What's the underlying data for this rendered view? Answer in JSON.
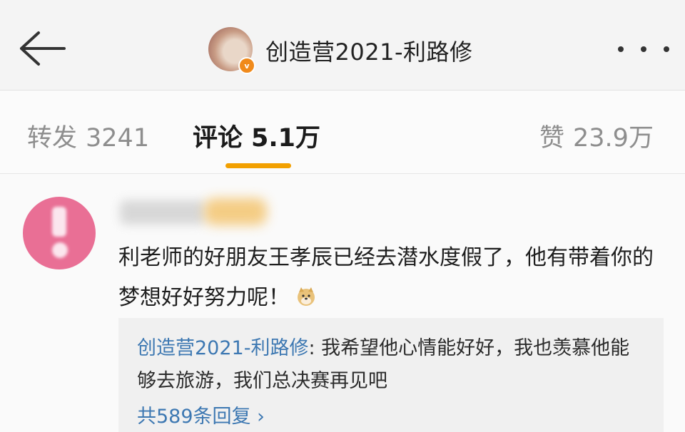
{
  "header": {
    "title": "创造营2021-利路修",
    "verified_mark": "v"
  },
  "tabs": {
    "repost": {
      "label": "转发",
      "count": "3241"
    },
    "comments": {
      "label": "评论",
      "count": "5.1万"
    },
    "likes": {
      "label": "赞",
      "count": "23.9万"
    }
  },
  "comment": {
    "text_before": "利老师的好朋友王孝辰已经去潜水度假了，他有带着你的梦想好好努力呢！",
    "emoji": "doge-icon",
    "reply": {
      "author": "创造营2021-利路修",
      "separator": ": ",
      "text": "我希望他心情能好好，我也羡慕他能够去旅游，我们总决赛再见吧",
      "count_label": "共589条回复 ›"
    }
  },
  "colors": {
    "accent": "#f2a000",
    "link": "#3d78b2",
    "avatar_pink": "#e96f95"
  }
}
